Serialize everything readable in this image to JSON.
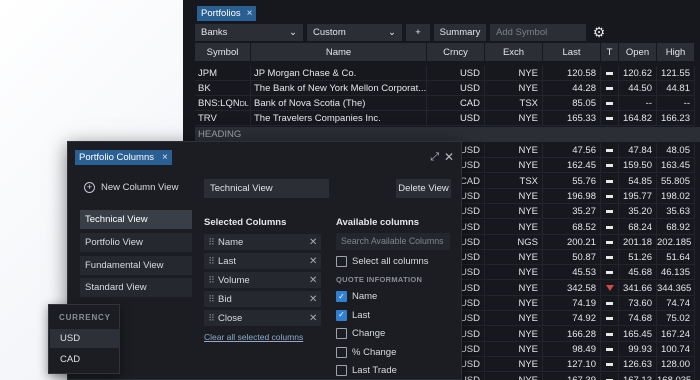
{
  "portfolio_tab": "Portfolios",
  "toolbar": {
    "portfolio_select": "Banks",
    "view_select": "Custom",
    "add_label": "+",
    "summary_label": "Summary",
    "add_symbol_placeholder": "Add Symbol"
  },
  "columns": [
    "Symbol",
    "Name",
    "Crncy",
    "Exch",
    "Last",
    "T",
    "Open",
    "High"
  ],
  "rows": [
    {
      "symbol": "JPM",
      "name": "JP Morgan Chase & Co.",
      "currency": "USD",
      "exchange": "NYE",
      "last": "120.58",
      "trend": "flat",
      "open": "120.62",
      "high": "121.55"
    },
    {
      "symbol": "BK",
      "name": "The Bank of New York Mellon Corporat...",
      "currency": "USD",
      "exchange": "NYE",
      "last": "44.28",
      "trend": "flat",
      "open": "44.50",
      "high": "44.81"
    },
    {
      "symbol": "BNS:LQN",
      "symbol_suffix": "DL",
      "name": "Bank of Nova Scotia (The)",
      "currency": "CAD",
      "exchange": "TSX",
      "last": "85.05",
      "trend": "flat",
      "open": "--",
      "high": "--"
    },
    {
      "symbol": "TRV",
      "name": "The Travelers Companies Inc.",
      "currency": "USD",
      "exchange": "NYE",
      "last": "165.33",
      "trend": "flat",
      "open": "164.82",
      "high": "166.23"
    }
  ],
  "heading_label": "HEADING",
  "lower_rows": [
    {
      "currency": "USD",
      "exchange": "NYE",
      "last": "47.56",
      "trend": "flat",
      "open": "47.84",
      "high": "48.05"
    },
    {
      "currency": "USD",
      "exchange": "NYE",
      "last": "162.45",
      "trend": "flat",
      "open": "159.50",
      "high": "163.45"
    },
    {
      "currency": "CAD",
      "exchange": "TSX",
      "last": "55.76",
      "trend": "flat",
      "open": "54.85",
      "high": "55.805"
    },
    {
      "currency": "USD",
      "exchange": "NYE",
      "last": "196.98",
      "trend": "flat",
      "open": "195.77",
      "high": "198.02"
    },
    {
      "currency": "USD",
      "exchange": "NYE",
      "last": "35.27",
      "trend": "flat",
      "open": "35.20",
      "high": "35.63"
    },
    {
      "currency": "USD",
      "exchange": "NYE",
      "last": "68.52",
      "trend": "flat",
      "open": "68.24",
      "high": "68.92"
    },
    {
      "currency": "USD",
      "exchange": "NGS",
      "last": "200.21",
      "trend": "flat",
      "open": "201.18",
      "high": "202.185"
    },
    {
      "currency": "USD",
      "exchange": "NYE",
      "last": "50.87",
      "trend": "flat",
      "open": "51.26",
      "high": "51.64"
    },
    {
      "currency": "USD",
      "exchange": "NYE",
      "last": "45.53",
      "trend": "flat",
      "open": "45.68",
      "high": "46.135"
    },
    {
      "currency": "USD",
      "exchange": "NYE",
      "last": "342.58",
      "trend": "down",
      "open": "341.66",
      "high": "344.365"
    },
    {
      "currency": "USD",
      "exchange": "NYE",
      "last": "74.19",
      "trend": "flat",
      "open": "73.60",
      "high": "74.74"
    },
    {
      "currency": "USD",
      "exchange": "NYE",
      "last": "74.92",
      "trend": "flat",
      "open": "74.68",
      "high": "75.02"
    },
    {
      "currency": "USD",
      "exchange": "NYE",
      "last": "166.28",
      "trend": "flat",
      "open": "165.45",
      "high": "167.24"
    },
    {
      "currency": "USD",
      "exchange": "NYE",
      "last": "98.49",
      "trend": "flat",
      "open": "99.93",
      "high": "100.74"
    },
    {
      "currency": "USD",
      "exchange": "NYE",
      "last": "127.10",
      "trend": "flat",
      "open": "126.63",
      "high": "128.00"
    },
    {
      "currency": "USD",
      "exchange": "NYE",
      "last": "167.39",
      "trend": "flat",
      "open": "167.13",
      "high": "168.035"
    }
  ],
  "dialog": {
    "tab_label": "Portfolio Columns",
    "new_view_label": "New Column View",
    "view_name_value": "Technical View",
    "delete_view_label": "Delete View",
    "views": [
      "Technical View",
      "Portfolio View",
      "Fundamental View",
      "Standard View"
    ],
    "selected_title": "Selected Columns",
    "selected_columns": [
      "Name",
      "Last",
      "Volume",
      "Bid",
      "Close"
    ],
    "clear_all_label": "Clear all selected columns",
    "available_title": "Available columns",
    "search_placeholder": "Search Available Columns",
    "select_all_label": "Select all columns",
    "section_label": "QUOTE INFORMATION",
    "available_columns": [
      {
        "label": "Name",
        "checked": true
      },
      {
        "label": "Last",
        "checked": true
      },
      {
        "label": "Change",
        "checked": false
      },
      {
        "label": "% Change",
        "checked": false
      },
      {
        "label": "Last Trade",
        "checked": false
      }
    ]
  },
  "currency_popup": {
    "title": "CURRENCY",
    "options": [
      "USD",
      "CAD"
    ]
  }
}
